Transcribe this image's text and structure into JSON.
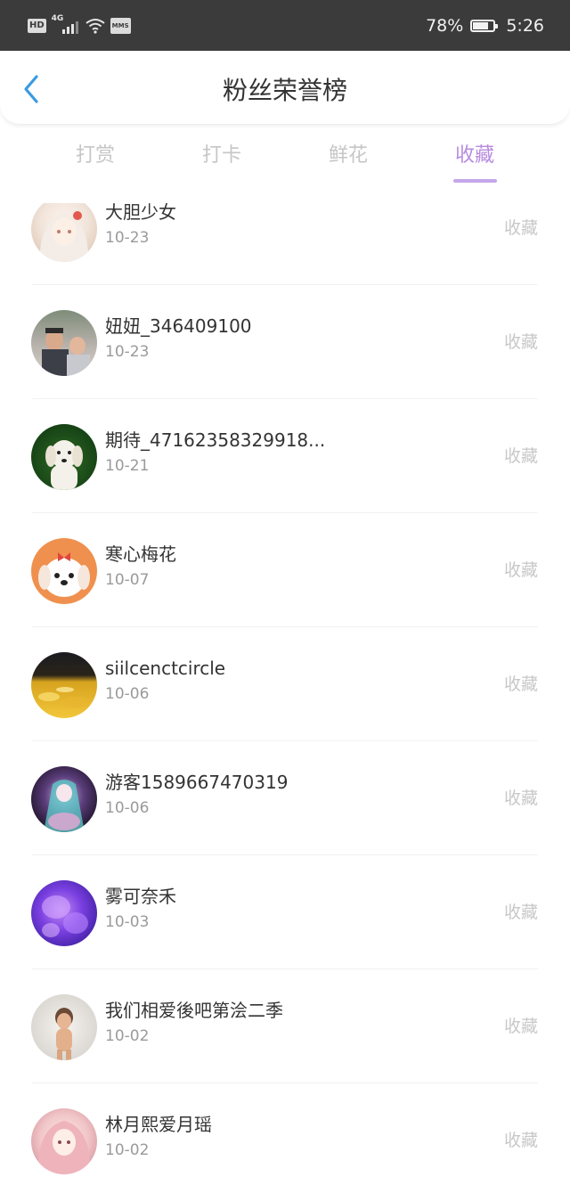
{
  "status_bar": {
    "hd_badge": "HD",
    "network_type": "4G",
    "msg_badge": "MMS",
    "battery_percent": "78%",
    "battery_level": 0.78,
    "time": "5:26"
  },
  "header": {
    "title": "粉丝荣誉榜",
    "back_icon": "chevron-left-icon",
    "accent_color": "#3a9be0"
  },
  "tabs": {
    "active_color": "#b88be0",
    "items": [
      {
        "label": "打赏"
      },
      {
        "label": "打卡"
      },
      {
        "label": "鲜花"
      },
      {
        "label": "收藏"
      }
    ],
    "active_index": 3
  },
  "list": {
    "items": [
      {
        "name": "大胆少女",
        "date": "10-23",
        "type": "收藏",
        "avatar": "anime-girl-white-hair"
      },
      {
        "name": "妞妞_346409100",
        "date": "10-23",
        "type": "收藏",
        "avatar": "family-photo"
      },
      {
        "name": "期待_47162358329918...",
        "date": "10-21",
        "type": "收藏",
        "avatar": "white-dog"
      },
      {
        "name": "寒心梅花",
        "date": "10-07",
        "type": "收藏",
        "avatar": "cartoon-puppy"
      },
      {
        "name": "siilcenctcircle",
        "date": "10-06",
        "type": "收藏",
        "avatar": "golden-landscape"
      },
      {
        "name": "游客1589667470319",
        "date": "10-06",
        "type": "收藏",
        "avatar": "anime-miku"
      },
      {
        "name": "雾可奈禾",
        "date": "10-03",
        "type": "收藏",
        "avatar": "purple-jellyfish"
      },
      {
        "name": "我们相爱後吧第浍二季",
        "date": "10-02",
        "type": "收藏",
        "avatar": "baby-doll"
      },
      {
        "name": "林月熙爱月瑶",
        "date": "10-02",
        "type": "收藏",
        "avatar": "anime-pink-hair"
      }
    ]
  }
}
